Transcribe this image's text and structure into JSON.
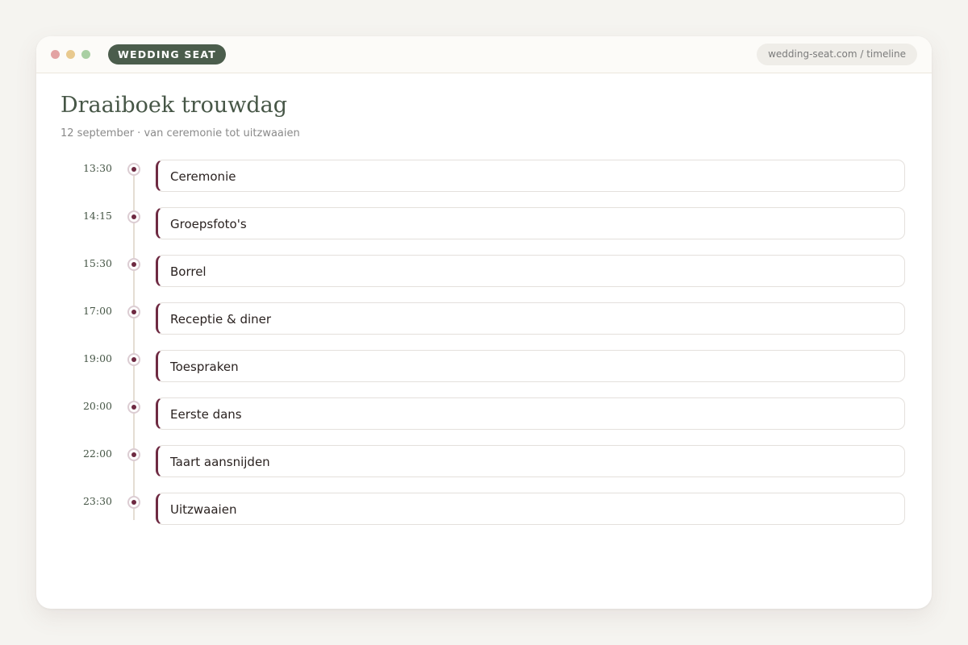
{
  "window": {
    "brand": "WEDDING SEAT",
    "url": "wedding-seat.com / timeline"
  },
  "page": {
    "title": "Draaiboek trouwdag",
    "subtitle": "12 september · van ceremonie tot uitzwaaien"
  },
  "timeline": {
    "events": [
      {
        "time": "13:30",
        "title": "Ceremonie"
      },
      {
        "time": "14:15",
        "title": "Groepsfoto's"
      },
      {
        "time": "15:30",
        "title": "Borrel"
      },
      {
        "time": "17:00",
        "title": "Receptie & diner"
      },
      {
        "time": "19:00",
        "title": "Toespraken"
      },
      {
        "time": "20:00",
        "title": "Eerste dans"
      },
      {
        "time": "22:00",
        "title": "Taart aansnijden"
      },
      {
        "time": "23:30",
        "title": "Uitzwaaien"
      }
    ]
  },
  "colors": {
    "brand": "#4b5d4c",
    "accent": "#6e2a42",
    "background": "#f5f4f0"
  }
}
